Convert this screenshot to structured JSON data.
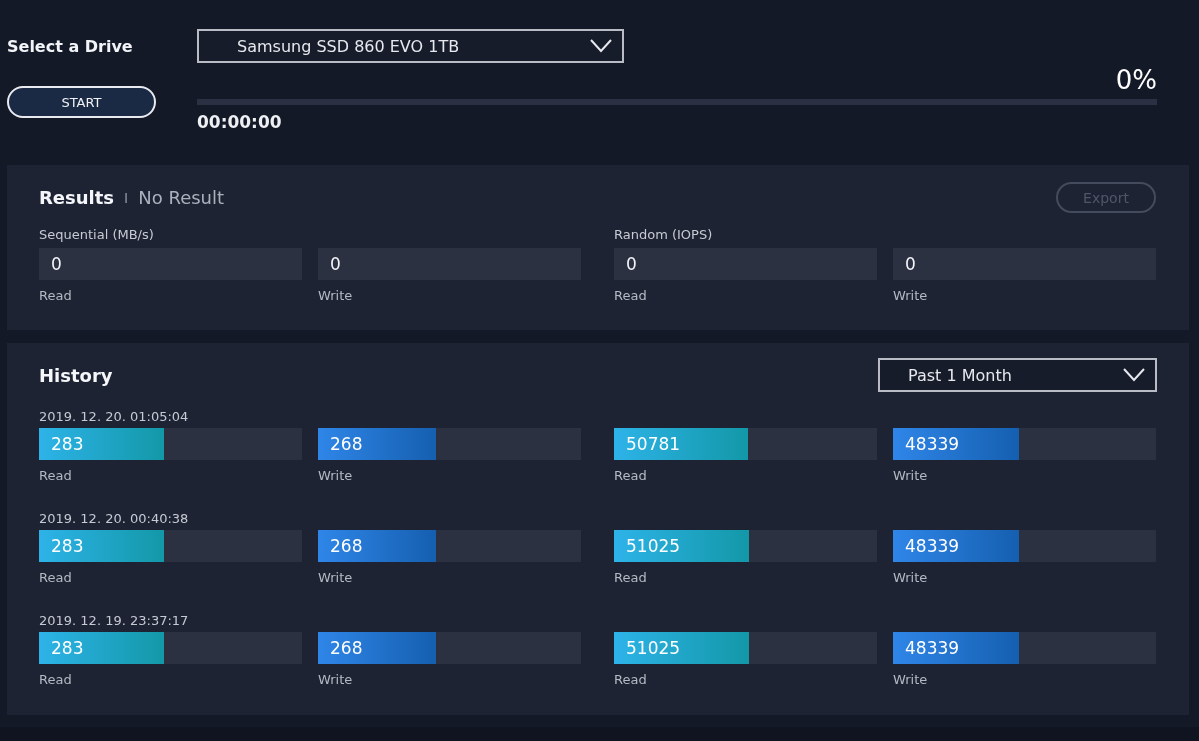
{
  "drive_select": {
    "label": "Select a Drive",
    "value": "Samsung SSD 860 EVO 1TB"
  },
  "start_button": {
    "label": "START"
  },
  "progress": {
    "level": 0,
    "percent": "0%",
    "elapsed": "00:00:00"
  },
  "results": {
    "title": "Results",
    "separator": "I",
    "status": "No Result",
    "export_button": {
      "label": "Export",
      "disabled": true
    },
    "groups": [
      {
        "title": "Sequential (MB/s)",
        "fields": [
          {
            "value": "0",
            "label": "Read"
          },
          {
            "value": "0",
            "label": "Write"
          }
        ]
      },
      {
        "title": "Random (IOPS)",
        "fields": [
          {
            "value": "0",
            "label": "Read"
          },
          {
            "value": "0",
            "label": "Write"
          }
        ]
      }
    ]
  },
  "history": {
    "title": "History",
    "period": "Past 1 Month",
    "entries": [
      {
        "timestamp": "2019. 12. 20. 01:05:04",
        "metrics": [
          {
            "kind": "read",
            "value": "283",
            "level": 0.475,
            "label": "Read"
          },
          {
            "kind": "write",
            "value": "268",
            "level": 0.45,
            "label": "Write"
          },
          {
            "kind": "read",
            "value": "50781",
            "level": 0.51,
            "label": "Read"
          },
          {
            "kind": "write",
            "value": "48339",
            "level": 0.48,
            "label": "Write"
          }
        ]
      },
      {
        "timestamp": "2019. 12. 20. 00:40:38",
        "metrics": [
          {
            "kind": "read",
            "value": "283",
            "level": 0.475,
            "label": "Read"
          },
          {
            "kind": "write",
            "value": "268",
            "level": 0.45,
            "label": "Write"
          },
          {
            "kind": "read",
            "value": "51025",
            "level": 0.515,
            "label": "Read"
          },
          {
            "kind": "write",
            "value": "48339",
            "level": 0.48,
            "label": "Write"
          }
        ]
      },
      {
        "timestamp": "2019. 12. 19. 23:37:17",
        "metrics": [
          {
            "kind": "read",
            "value": "283",
            "level": 0.475,
            "label": "Read"
          },
          {
            "kind": "write",
            "value": "268",
            "level": 0.45,
            "label": "Write"
          },
          {
            "kind": "read",
            "value": "51025",
            "level": 0.515,
            "label": "Read"
          },
          {
            "kind": "write",
            "value": "48339",
            "level": 0.48,
            "label": "Write"
          }
        ]
      }
    ]
  }
}
